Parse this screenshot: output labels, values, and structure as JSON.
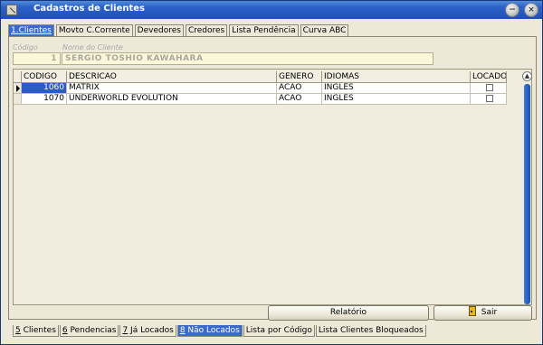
{
  "window": {
    "title": "Cadastros de Clientes",
    "min_glyph": "−",
    "close_glyph": "×"
  },
  "top_tabs": [
    {
      "label": "1.Clientes",
      "active": true
    },
    {
      "label": "Movto C.Corrente",
      "active": false
    },
    {
      "label": "Devedores",
      "active": false
    },
    {
      "label": "Credores",
      "active": false
    },
    {
      "label": "Lista Pendência",
      "active": false
    },
    {
      "label": "Curva ABC",
      "active": false
    }
  ],
  "client": {
    "codigo_label": "Código",
    "codigo_value": "1",
    "nome_label": "Nome do Cliente",
    "nome_value": "SERGIO TOSHIO KAWAHARA"
  },
  "grid": {
    "columns": [
      "CODIGO",
      "DESCRICAO",
      "GENERO",
      "IDIOMAS",
      "LOCADO"
    ],
    "rows": [
      {
        "codigo": "1060",
        "descricao": "MATRIX",
        "genero": "ACAO",
        "idiomas": "INGLES",
        "locado": false,
        "selected": true
      },
      {
        "codigo": "1070",
        "descricao": "UNDERWORLD EVOLUTION",
        "genero": "ACAO",
        "idiomas": "INGLES",
        "locado": false,
        "selected": false
      }
    ]
  },
  "buttons": {
    "relatorio": "Relatório",
    "sair": "Sair"
  },
  "bottom_tabs": [
    {
      "num": "5",
      "label": " Clientes",
      "active": false
    },
    {
      "num": "6",
      "label": " Pendencias",
      "active": false
    },
    {
      "num": "7",
      "label": " Já Locados",
      "active": false
    },
    {
      "num": "8",
      "label": " Não Locados",
      "active": true
    },
    {
      "num": "",
      "label": "Lista por Código",
      "active": false
    },
    {
      "num": "",
      "label": "Lista Clientes Bloqueados",
      "active": false
    }
  ],
  "colors": {
    "titlebar": "#2a62c9",
    "selection": "#2a5bc8",
    "field_bg": "#fbf8da"
  }
}
